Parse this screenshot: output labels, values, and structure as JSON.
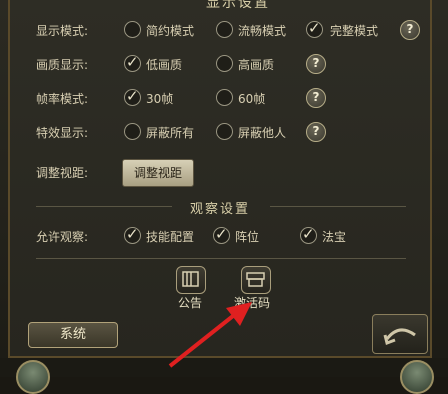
{
  "header": {
    "title": "显示设置"
  },
  "display_mode": {
    "label": "显示模式:",
    "options": [
      "简约模式",
      "流畅模式",
      "完整模式"
    ],
    "selected": "完整模式"
  },
  "quality": {
    "label": "画质显示:",
    "options": [
      "低画质",
      "高画质"
    ],
    "selected": "低画质"
  },
  "fps": {
    "label": "帧率模式:",
    "options": [
      "30帧",
      "60帧"
    ],
    "selected": "30帧"
  },
  "effects": {
    "label": "特效显示:",
    "options": [
      "屏蔽所有",
      "屏蔽他人"
    ],
    "selected": ""
  },
  "view_distance": {
    "label": "调整视距:",
    "button": "调整视距"
  },
  "observe": {
    "section_title": "观察设置",
    "label": "允许观察:",
    "options": [
      "技能配置",
      "阵位",
      "法宝"
    ],
    "checked": [
      "技能配置",
      "阵位",
      "法宝"
    ]
  },
  "help": {
    "glyph": "?"
  },
  "bottom_icons": {
    "notice": "公告",
    "activation_code": "激活码"
  },
  "footer": {
    "system_button": "系统"
  },
  "colors": {
    "panel": "#2b2a22",
    "text": "#d8cfb2",
    "border": "#5a4a2a",
    "arrow": "#e02020"
  }
}
